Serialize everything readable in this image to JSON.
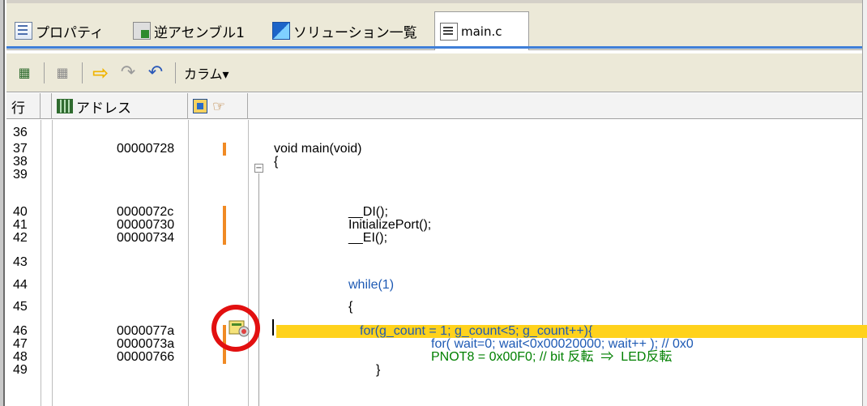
{
  "tabs": [
    {
      "label": "プロパティ",
      "icon": "properties-icon"
    },
    {
      "label": "逆アセンブル1",
      "icon": "disassembly-icon"
    },
    {
      "label": "ソリューション一覧",
      "icon": "solution-list-icon"
    },
    {
      "label": "main.c",
      "icon": "source-file-icon",
      "active": true
    }
  ],
  "toolbar": {
    "column_label": "カラム▾"
  },
  "columns": {
    "line": "行",
    "address": "アドレス"
  },
  "rows": [
    {
      "line": "36",
      "address": "",
      "code": ""
    },
    {
      "line": "37",
      "address": "00000728",
      "code": "void main(void)"
    },
    {
      "line": "38",
      "address": "",
      "code": "{"
    },
    {
      "line": "39",
      "address": "",
      "code": ""
    },
    {
      "line": "40",
      "address": "0000072c",
      "code": "__DI();"
    },
    {
      "line": "41",
      "address": "00000730",
      "code": "InitializePort();"
    },
    {
      "line": "42",
      "address": "00000734",
      "code": "__EI();"
    },
    {
      "line": "43",
      "address": "",
      "code": ""
    },
    {
      "line": "44",
      "address": "",
      "code": "while(1)"
    },
    {
      "line": "45",
      "address": "",
      "code": "{"
    },
    {
      "line": "46",
      "address": "0000077a",
      "code": "for(g_count = 1; g_count<5; g_count++){"
    },
    {
      "line": "47",
      "address": "0000073a",
      "code": "for( wait=0; wait<0x00020000; wait++ ); // 0x0"
    },
    {
      "line": "48",
      "address": "00000766",
      "code": "PNOT8 = 0x00F0; // bit 反転  ⇒  LED反転"
    },
    {
      "line": "49",
      "address": "",
      "code": "}"
    }
  ],
  "colors": {
    "highlight": "#ffd21c",
    "keyword": "#1e5ab4",
    "comment": "#008000",
    "marker": "#f08a24",
    "annotation_circle": "#e21010"
  }
}
